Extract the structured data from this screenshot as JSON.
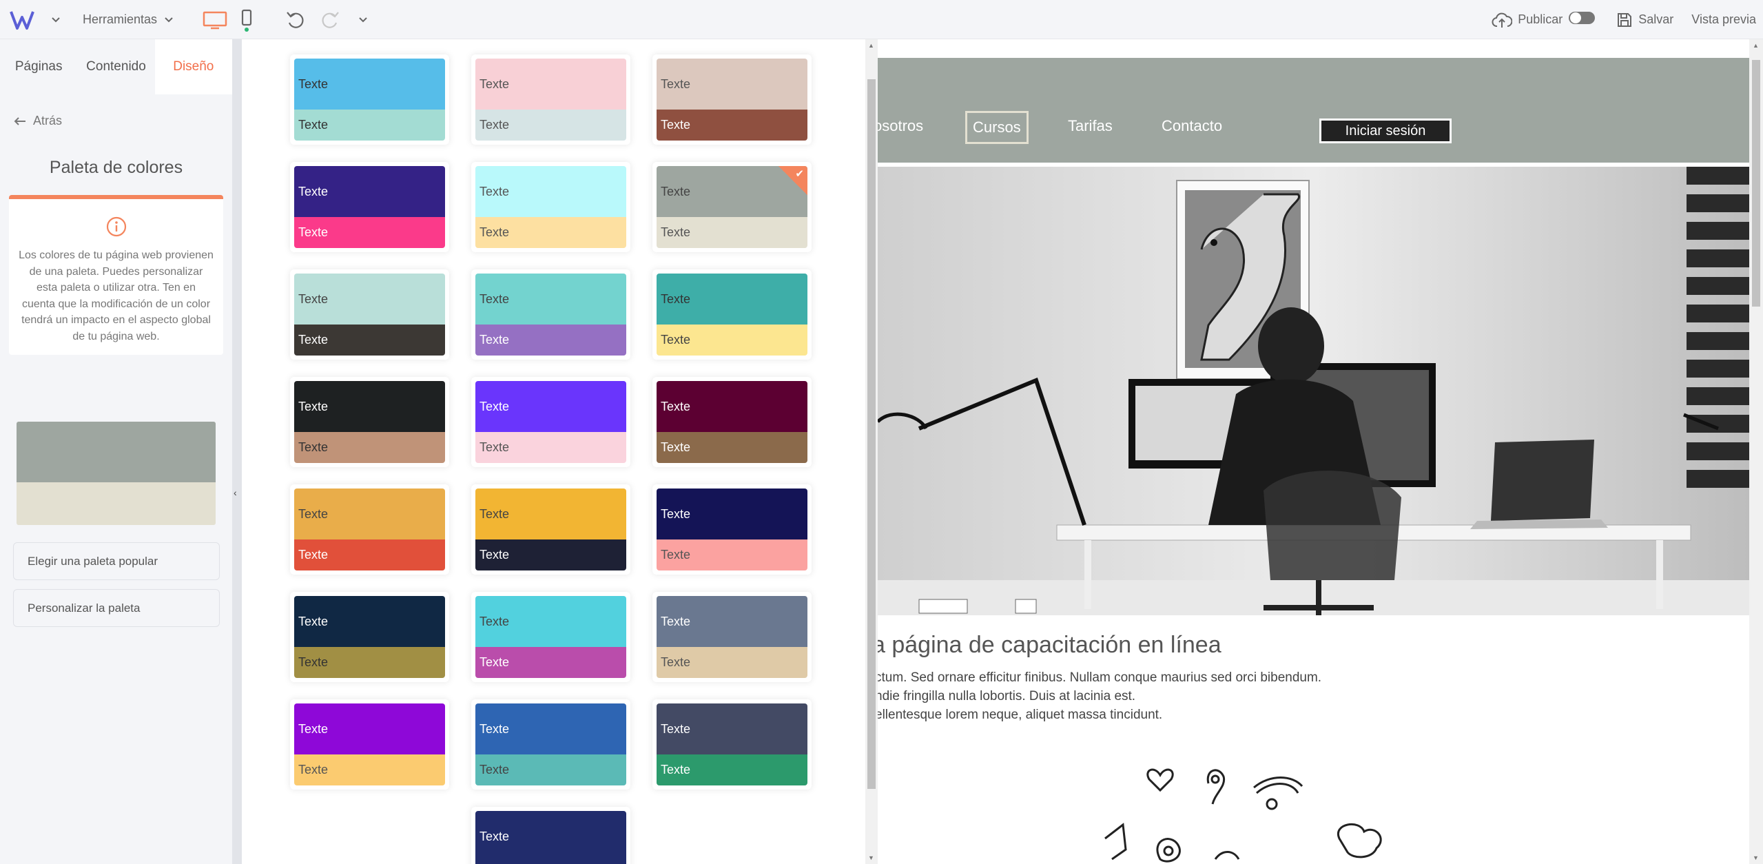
{
  "toolbar": {
    "tools_label": "Herramientas",
    "publish_label": "Publicar",
    "save_label": "Salvar",
    "preview_label": "Vista previa",
    "accent": "#f26f4a"
  },
  "sidebar": {
    "tabs": [
      {
        "label": "Páginas"
      },
      {
        "label": "Contenido"
      },
      {
        "label": "Diseño"
      }
    ],
    "back_label": "Atrás",
    "title": "Paleta de colores",
    "info_text": "Los colores de tu página web provienen de una paleta. Puedes personalizar esta paleta o utilizar otra. Ten en cuenta que la modificación de un color tendrá un impacto en el aspecto global de tu página web.",
    "current_palette": {
      "primary": "#9ea6a0",
      "secondary": "#e3e0d1"
    },
    "choose_popular_label": "Elegir una paleta popular",
    "customize_label": "Personalizar la paleta"
  },
  "palettes": [
    {
      "c1": "#56bde9",
      "t1": "#333",
      "c2": "#a3dcd3",
      "t2": "#333",
      "label1": "Texte",
      "label2": "Texte"
    },
    {
      "c1": "#f8d0d6",
      "t1": "#555",
      "c2": "#d6e4e5",
      "t2": "#555",
      "label1": "Texte",
      "label2": "Texte"
    },
    {
      "c1": "#dcc8be",
      "t1": "#555",
      "c2": "#8f5040",
      "t2": "#fff",
      "label1": "Texte",
      "label2": "Texte"
    },
    {
      "c1": "#342286",
      "t1": "#fff",
      "c2": "#fb3a8a",
      "t2": "#fff",
      "label1": "Texte",
      "label2": "Texte"
    },
    {
      "c1": "#b9f9fb",
      "t1": "#555",
      "c2": "#fde0a1",
      "t2": "#555",
      "label1": "Texte",
      "label2": "Texte"
    },
    {
      "c1": "#9ea6a0",
      "t1": "#444",
      "c2": "#e3e0d1",
      "t2": "#555",
      "label1": "Texte",
      "label2": "Texte",
      "selected": true
    },
    {
      "c1": "#b9dfd9",
      "t1": "#444",
      "c2": "#3c3834",
      "t2": "#fff",
      "label1": "Texte",
      "label2": "Texte"
    },
    {
      "c1": "#73d3cf",
      "t1": "#444",
      "c2": "#9570c3",
      "t2": "#fff",
      "label1": "Texte",
      "label2": "Texte"
    },
    {
      "c1": "#3eaea8",
      "t1": "#333",
      "c2": "#fce690",
      "t2": "#444",
      "label1": "Texte",
      "label2": "Texte"
    },
    {
      "c1": "#1e2122",
      "t1": "#fff",
      "c2": "#c09378",
      "t2": "#333",
      "label1": "Texte",
      "label2": "Texte"
    },
    {
      "c1": "#6a35fc",
      "t1": "#fff",
      "c2": "#fad3dd",
      "t2": "#555",
      "label1": "Texte",
      "label2": "Texte"
    },
    {
      "c1": "#5c0032",
      "t1": "#fff",
      "c2": "#8b6a4b",
      "t2": "#fff",
      "label1": "Texte",
      "label2": "Texte"
    },
    {
      "c1": "#e9ad4a",
      "t1": "#444",
      "c2": "#e1503a",
      "t2": "#fff",
      "label1": "Texte",
      "label2": "Texte"
    },
    {
      "c1": "#f2b533",
      "t1": "#444",
      "c2": "#1e2135",
      "t2": "#fff",
      "label1": "Texte",
      "label2": "Texte"
    },
    {
      "c1": "#141456",
      "t1": "#fff",
      "c2": "#fba2a0",
      "t2": "#555",
      "label1": "Texte",
      "label2": "Texte"
    },
    {
      "c1": "#102844",
      "t1": "#fff",
      "c2": "#a18f44",
      "t2": "#333",
      "label1": "Texte",
      "label2": "Texte"
    },
    {
      "c1": "#52d1de",
      "t1": "#444",
      "c2": "#ba4dab",
      "t2": "#fff",
      "label1": "Texte",
      "label2": "Texte"
    },
    {
      "c1": "#6a7890",
      "t1": "#fff",
      "c2": "#dfcaa7",
      "t2": "#555",
      "label1": "Texte",
      "label2": "Texte"
    },
    {
      "c1": "#8e08d8",
      "t1": "#fff",
      "c2": "#fbcb70",
      "t2": "#555",
      "label1": "Texte",
      "label2": "Texte"
    },
    {
      "c1": "#2e65b3",
      "t1": "#fff",
      "c2": "#5bbab6",
      "t2": "#444",
      "label1": "Texte",
      "label2": "Texte"
    },
    {
      "c1": "#434a64",
      "t1": "#fff",
      "c2": "#2c9a6c",
      "t2": "#fff",
      "label1": "Texte",
      "label2": "Texte"
    },
    {
      "c1": "#212c6c",
      "t1": "#fff",
      "c2": "#212c6c",
      "t2": "#fff",
      "label1": "Texte",
      "label2": ""
    }
  ],
  "site": {
    "nav_items": [
      "osotros",
      "Cursos",
      "Tarifas",
      "Contacto"
    ],
    "active_nav": "Cursos",
    "login_label": "Iniciar sesión",
    "heading": "a página de capacitación en línea",
    "paragraph_lines": [
      "ctum. Sed ornare efficitur finibus. Nullam conque maurius sed orci bibendum.",
      "ndie fringilla nulla lobortis. Duis at lacinia est.",
      "ellentesque lorem neque, aliquet massa tincidunt."
    ],
    "nav_color": "#9ea6a0"
  }
}
